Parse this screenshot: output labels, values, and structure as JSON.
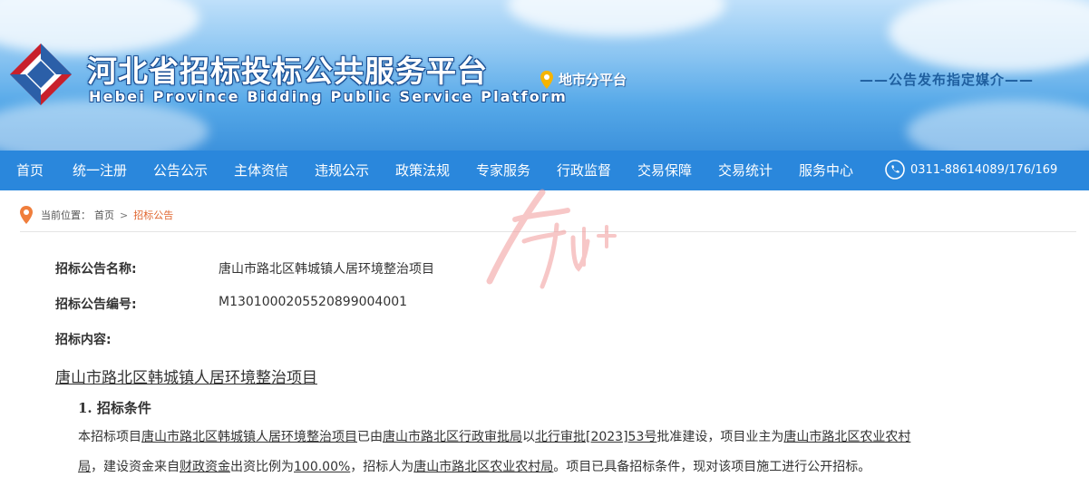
{
  "header": {
    "site_title": "河北省招标投标公共服务平台",
    "site_subtitle": "Hebei Province Bidding Public Service Platform",
    "city_platform_label": "地市分平台",
    "slogan": "——公告发布指定媒介——"
  },
  "nav": {
    "items": [
      "首页",
      "统一注册",
      "公告公示",
      "主体资信",
      "违规公示",
      "政策法规",
      "专家服务",
      "行政监督",
      "交易保障",
      "交易统计",
      "服务中心"
    ],
    "phone": "0311-88614089/176/169"
  },
  "breadcrumb": {
    "label": "当前位置：",
    "home": "首页",
    "separator": ">",
    "current": "招标公告"
  },
  "notice": {
    "name_label": "招标公告名称:",
    "name_value": "唐山市路北区韩城镇人居环境整治项目",
    "code_label": "招标公告编号:",
    "code_value": "M1301000205520899004001",
    "content_label": "招标内容:"
  },
  "doc": {
    "project_title": "唐山市路北区韩城镇人居环境整治项目",
    "section1_heading": "1.  招标条件",
    "line1": {
      "t1": "本招标项目",
      "project": "唐山市路北区韩城镇人居环境整治项目",
      "t2": "已由",
      "approver": "唐山市路北区行政审批局",
      "t3": "以",
      "approval_no": "北行审批[2023]53号",
      "t4": "批准建设，项目业主为",
      "owner": "唐山市路北区农业农村"
    },
    "line2": {
      "owner_tail": "局",
      "t1": "，建设资金来自",
      "fund_source": "财政资金",
      "t2": "出资比例为",
      "ratio": "100.00%",
      "t3": "，招标人为",
      "tenderer": "唐山市路北区农业农村局",
      "t4": "。项目已具备招标条件，现对该项目施工进行公开招标。"
    }
  },
  "colors": {
    "nav_bg": "#2a87dc",
    "breadcrumb_current": "#e0662f",
    "watermark": "#f19a9a"
  }
}
